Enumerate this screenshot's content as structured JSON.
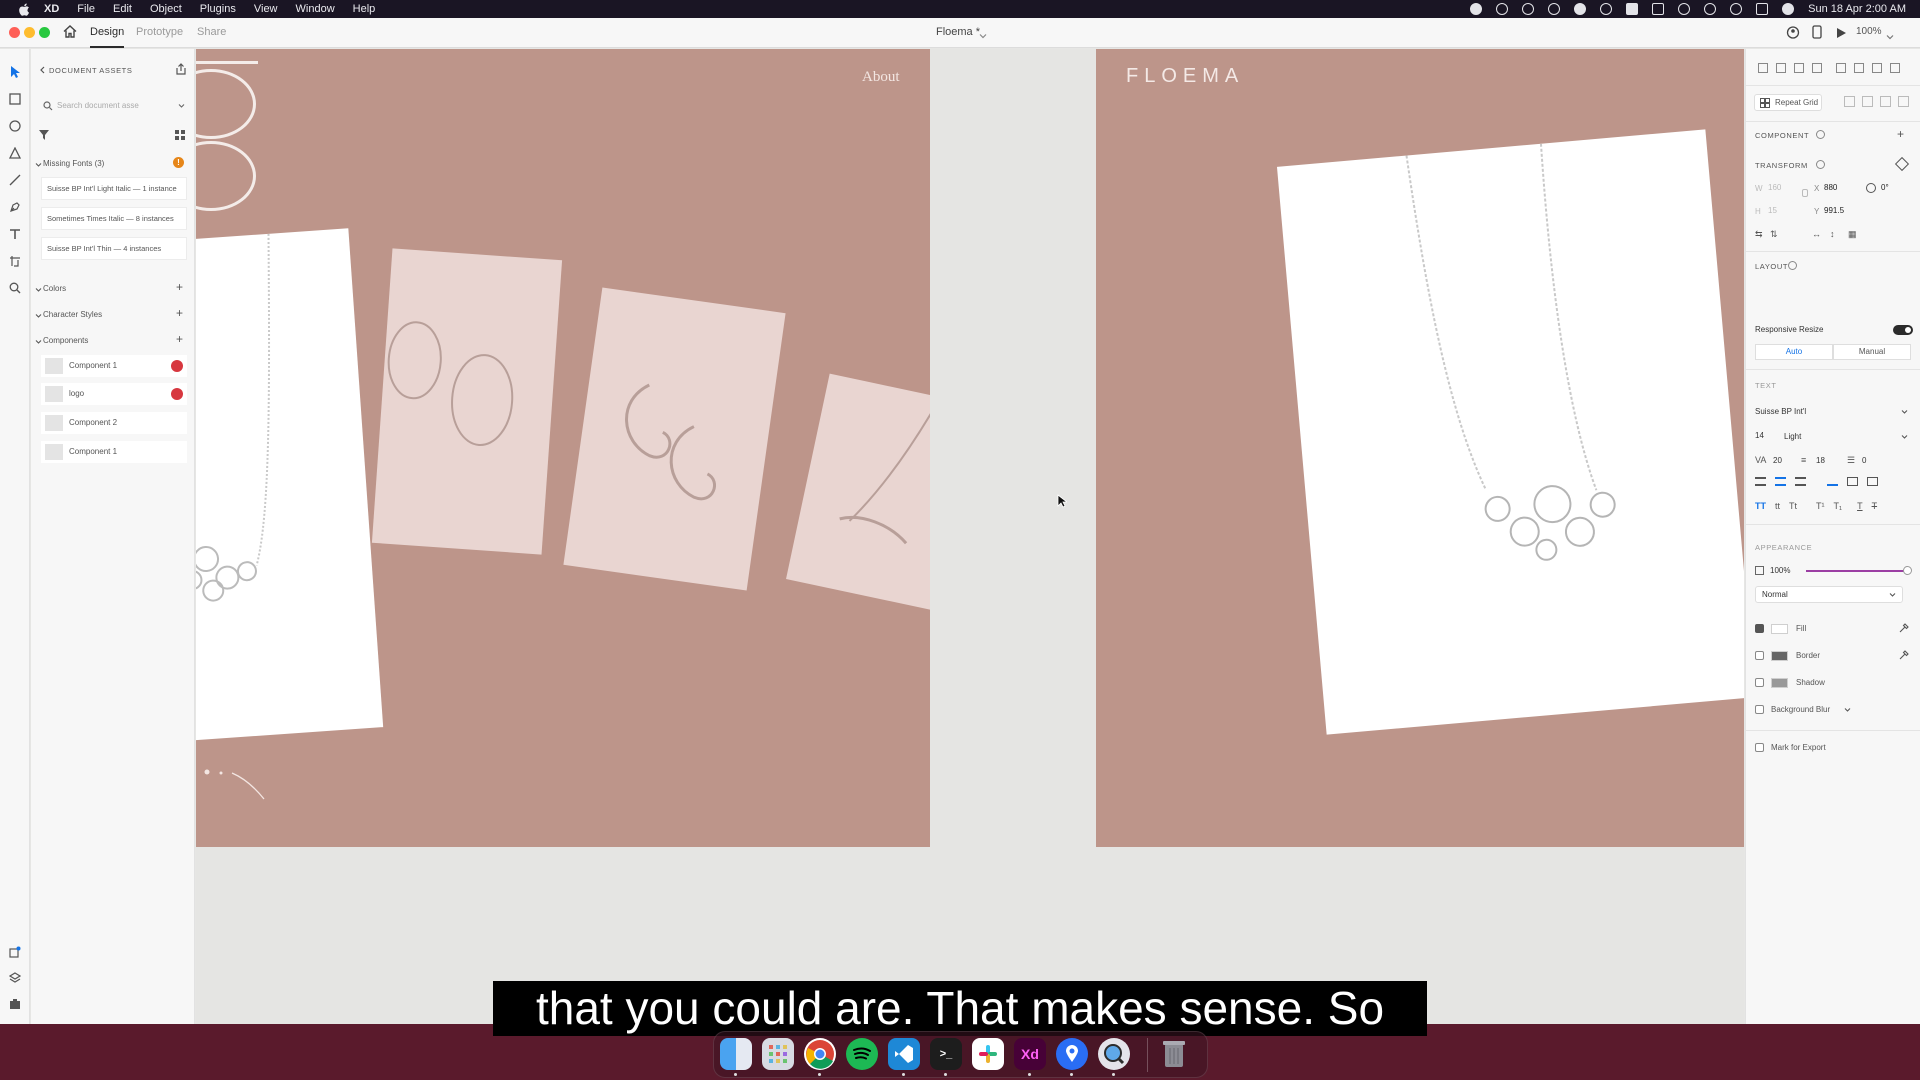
{
  "menubar": {
    "app": "XD",
    "items": [
      "File",
      "Edit",
      "Object",
      "Plugins",
      "View",
      "Window",
      "Help"
    ],
    "datetime": "Sun 18 Apr  2:00 AM"
  },
  "titlebar": {
    "tabs": [
      "Design",
      "Prototype",
      "Share"
    ],
    "active_tab": "Design",
    "document_title": "Floema *",
    "zoom": "100%"
  },
  "assets": {
    "header": "DOCUMENT ASSETS",
    "search_placeholder": "Search document asse",
    "missing_fonts_label": "Missing Fonts (3)",
    "missing_fonts": [
      "Suisse BP Int'l Light Italic — 1 instance",
      "Sometimes Times Italic — 8 instances",
      "Suisse BP Int'l Thin — 4 instances"
    ],
    "colors_label": "Colors",
    "char_styles_label": "Character Styles",
    "components_label": "Components",
    "components": [
      {
        "name": "Component 1",
        "linked": true
      },
      {
        "name": "logo",
        "linked": true
      },
      {
        "name": "Component 2",
        "linked": false
      },
      {
        "name": "Component 1",
        "linked": false
      }
    ]
  },
  "canvas": {
    "about_text": "About",
    "logo_text": "FLOEMA",
    "artboard_color": "#bd958a"
  },
  "inspector": {
    "repeat_grid": "Repeat Grid",
    "component_label": "COMPONENT",
    "transform_label": "TRANSFORM",
    "w_label": "W",
    "w_value": "160",
    "h_label": "H",
    "h_value": "15",
    "x_label": "X",
    "x_value": "880",
    "y_label": "Y",
    "y_value": "991.5",
    "rotation": "0°",
    "layout_label": "LAYOUT",
    "responsive_resize": "Responsive Resize",
    "layout_auto": "Auto",
    "layout_manual": "Manual",
    "text_label": "TEXT",
    "font_family": "Suisse BP Int'l",
    "font_size": "14",
    "font_weight": "Light",
    "char_spacing": "20",
    "line_spacing": "18",
    "para_spacing": "0",
    "appearance_label": "APPEARANCE",
    "opacity": "100%",
    "blend_mode": "Normal",
    "fill_label": "Fill",
    "border_label": "Border",
    "shadow_label": "Shadow",
    "bg_blur_label": "Background Blur",
    "mark_export": "Mark for Export"
  },
  "caption": "that you could are. That makes sense. So",
  "dock": {
    "apps": [
      "finder",
      "launchpad",
      "chrome",
      "spotify",
      "vscode",
      "terminal",
      "slack",
      "xd",
      "maps",
      "quicktime",
      "trash"
    ]
  }
}
